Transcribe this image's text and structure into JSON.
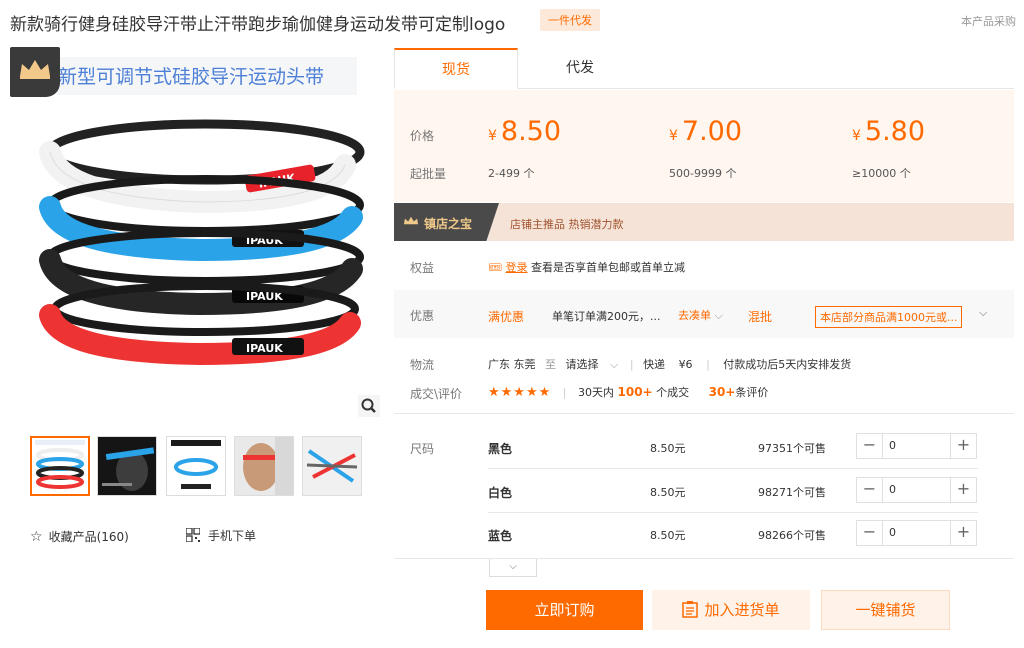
{
  "header": {
    "title": "新款骑行健身硅胶导汗带止汗带跑步瑜伽健身运动发带可定制logo",
    "badge": "一件代发",
    "right_link": "本产品采购"
  },
  "gallery": {
    "caption": "新型可调节式硅胶导汗运动头带",
    "brand_text": "IPAUK",
    "zoom_icon": "search-icon",
    "thumbnails": [
      "thumb-1",
      "thumb-2",
      "thumb-3",
      "thumb-4",
      "thumb-5"
    ],
    "band_colors": [
      "#f2f2f2",
      "#2aa3e8",
      "#222222",
      "#ee3333"
    ]
  },
  "actions": {
    "favorite": "收藏产品(160)",
    "mobile_order": "手机下单"
  },
  "tabs": [
    "现货",
    "代发"
  ],
  "pricing": {
    "price_label": "价格",
    "qty_label": "起批量",
    "currency": "¥",
    "tiers": [
      {
        "price": "8.50",
        "qty": "2-499 个"
      },
      {
        "price": "7.00",
        "qty": "500-9999 个"
      },
      {
        "price": "5.80",
        "qty": "≥10000 个"
      }
    ]
  },
  "banner": {
    "title": "镇店之宝",
    "text": "店铺主推品  热销潜力款"
  },
  "benefits": {
    "label": "权益",
    "login": "登录",
    "text": "查看是否享首单包邮或首单立减"
  },
  "discount": {
    "label": "优惠",
    "type": "满优惠",
    "desc": "单笔订单满200元，...",
    "link": "去凑单",
    "mixed": "混批",
    "promo": "本店部分商品满1000元或..."
  },
  "logistics": {
    "label": "物流",
    "from": "广东 东莞",
    "to_word": "至",
    "select": "请选择",
    "express": "快递",
    "fee": "¥6",
    "ship_note": "付款成功后5天内安排发货"
  },
  "reviews": {
    "label": "成交\\评价",
    "stars": "★★★★★",
    "prefix": "30天内",
    "deals": "100+",
    "deals_suffix": "个成交",
    "reviews": "30+",
    "reviews_suffix": "条评价"
  },
  "sizes": {
    "label": "尺码",
    "rows": [
      {
        "name": "黑色",
        "price": "8.50元",
        "stock": "97351个可售",
        "qty": "0"
      },
      {
        "name": "白色",
        "price": "8.50元",
        "stock": "98271个可售",
        "qty": "0"
      },
      {
        "name": "蓝色",
        "price": "8.50元",
        "stock": "98266个可售",
        "qty": "0"
      }
    ]
  },
  "buttons": {
    "order": "立即订购",
    "cart": "加入进货单",
    "shop": "一键铺货"
  }
}
